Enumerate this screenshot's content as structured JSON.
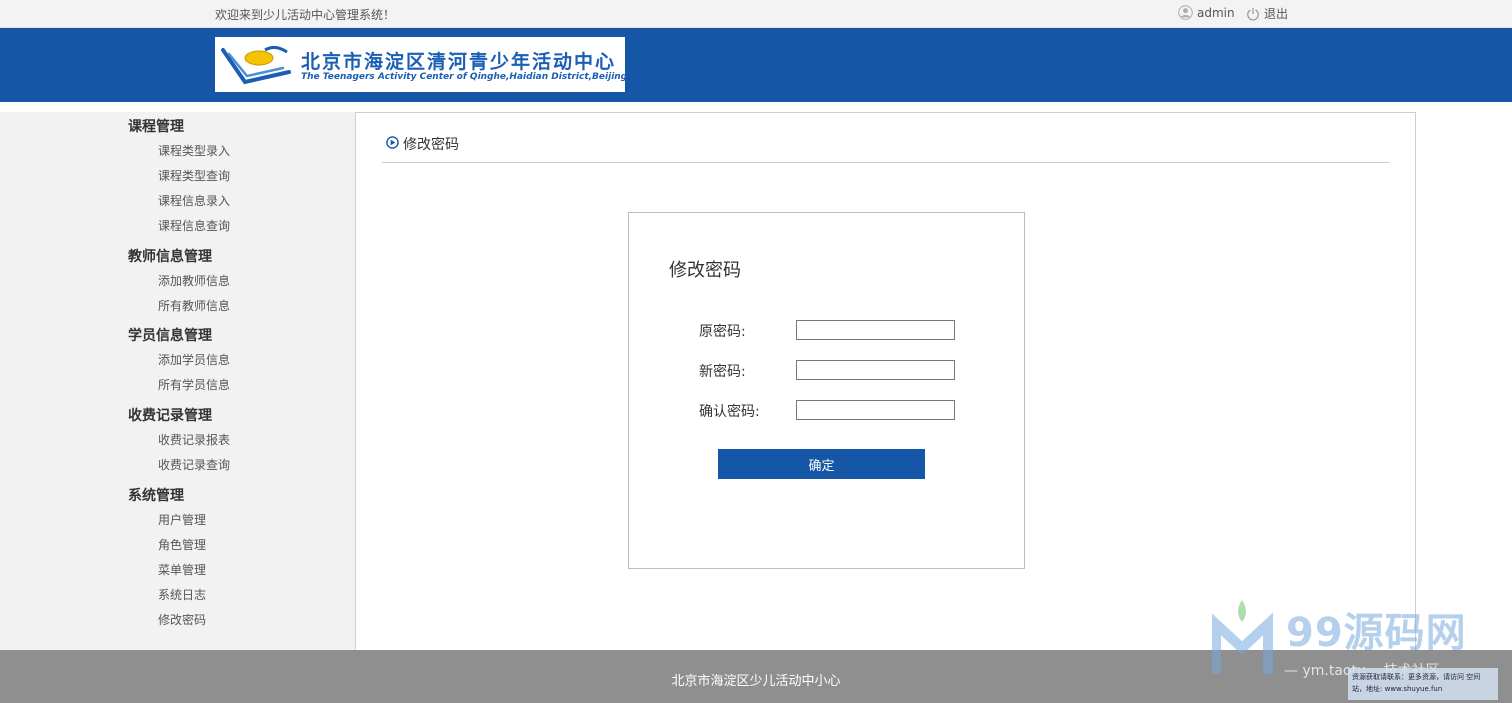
{
  "topbar": {
    "welcome": "欢迎来到少儿活动中心管理系统！",
    "username": "admin",
    "logout": "退出"
  },
  "logo": {
    "title_cn": "北京市海淀区清河青少年活动中心",
    "title_en": "The Teenagers Activity Center of Qinghe,Haidian District,Beijing"
  },
  "sidebar": {
    "groups": [
      {
        "title": "课程管理",
        "items": [
          "课程类型录入",
          "课程类型查询",
          "课程信息录入",
          "课程信息查询"
        ]
      },
      {
        "title": "教师信息管理",
        "items": [
          "添加教师信息",
          "所有教师信息"
        ]
      },
      {
        "title": "学员信息管理",
        "items": [
          "添加学员信息",
          "所有学员信息"
        ]
      },
      {
        "title": "收费记录管理",
        "items": [
          "收费记录报表",
          "收费记录查询"
        ]
      },
      {
        "title": "系统管理",
        "items": [
          "用户管理",
          "角色管理",
          "菜单管理",
          "系统日志",
          "修改密码"
        ]
      }
    ]
  },
  "main": {
    "breadcrumb": "修改密码",
    "form": {
      "title": "修改密码",
      "old_label": "原密码:",
      "old_value": "",
      "new_label": "新密码:",
      "new_value": "",
      "confirm_label": "确认密码:",
      "confirm_value": "",
      "submit": "确定"
    }
  },
  "footer": {
    "text": "北京市海淀区少儿活动中小心"
  },
  "watermark": {
    "brand": "99源码网",
    "sub": "— ym.taotu... 技术社区",
    "note": "资源获取请联系：更多资源，请访问 空间站，地址: www.shuyue.fun"
  },
  "colors": {
    "header_bg": "#1556a6",
    "button_bg": "#1556a6",
    "sidebar_bg": "#f2f2f2",
    "footer_bg": "#8f8f8f"
  }
}
